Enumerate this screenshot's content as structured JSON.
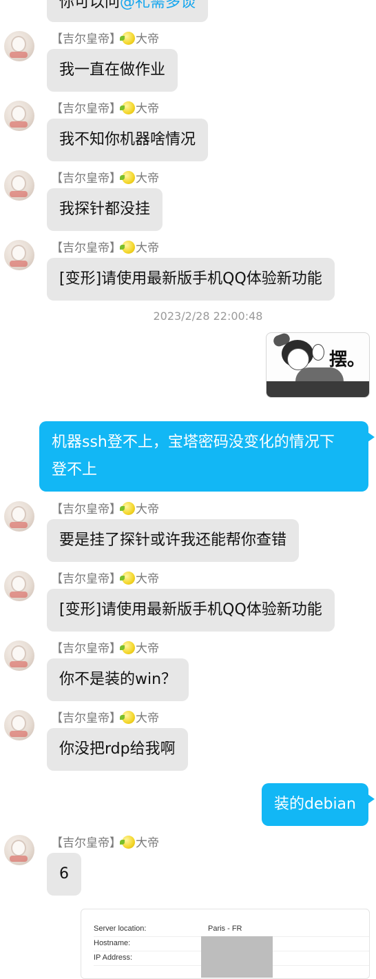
{
  "chat": {
    "top_partial": {
      "text": "你可以问",
      "mention": "@礼需多谈"
    },
    "sender_prefix": "【吉尔皇帝】",
    "sender_suffix": "大帝",
    "timestamp": "2023/2/28 22:00:48",
    "messages": [
      {
        "text": "我一直在做作业"
      },
      {
        "text": "我不知你机器啥情况"
      },
      {
        "text": "我探针都没挂"
      },
      {
        "text": "[变形]请使用最新版手机QQ体验新功能"
      },
      {
        "sticker_text": "摆。"
      },
      {
        "mine_line1": "机器ssh登不上，宝塔密码没变化的情况下",
        "mine_line2": "登不上"
      },
      {
        "text": "要是挂了探针或许我还能帮你查错"
      },
      {
        "text": "[变形]请使用最新版手机QQ体验新功能"
      },
      {
        "text": "你不是装的win？"
      },
      {
        "text": "你没把rdp给我啊"
      },
      {
        "mine": "装的debian"
      },
      {
        "text": "6"
      }
    ]
  },
  "card": {
    "rows": [
      {
        "label": "Server location:",
        "value": "Paris - FR"
      },
      {
        "label": "Hostname:",
        "value": ""
      },
      {
        "label": "IP Address:",
        "value": ""
      }
    ]
  }
}
